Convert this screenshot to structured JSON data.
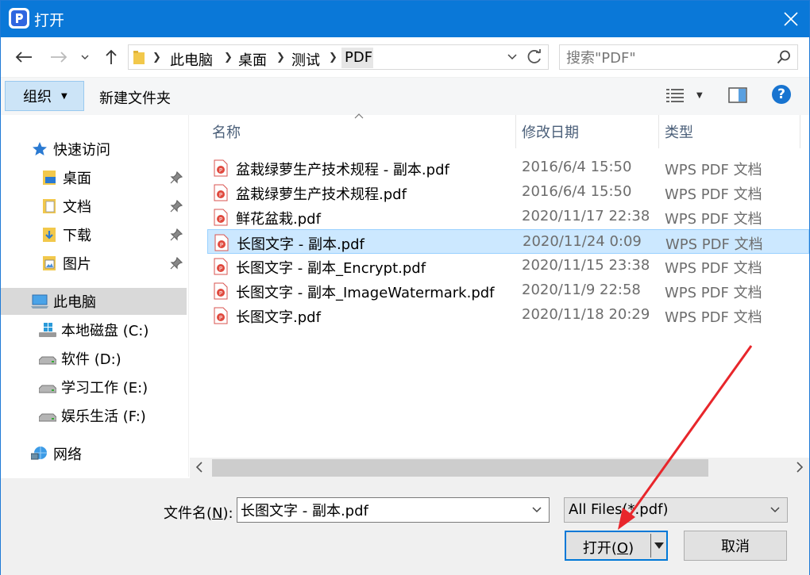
{
  "window": {
    "title": "打开"
  },
  "address": {
    "crumbs": [
      "此电脑",
      "桌面",
      "测试",
      "PDF"
    ]
  },
  "search": {
    "placeholder": "搜索\"PDF\""
  },
  "toolbar": {
    "organize_label": "组织",
    "new_folder_label": "新建文件夹",
    "help_label": "?"
  },
  "navpane": {
    "quick_access": "快速访问",
    "quick_items": [
      "桌面",
      "文档",
      "下载",
      "图片"
    ],
    "this_pc": "此电脑",
    "drives": [
      "本地磁盘 (C:)",
      "软件 (D:)",
      "学习工作 (E:)",
      "娱乐生活 (F:)"
    ],
    "network": "网络"
  },
  "filelist": {
    "columns": [
      "名称",
      "修改日期",
      "类型"
    ],
    "rows": [
      {
        "name": "盆栽绿萝生产技术规程 - 副本.pdf",
        "date": "2016/6/4 15:50",
        "type": "WPS PDF 文档"
      },
      {
        "name": "盆栽绿萝生产技术规程.pdf",
        "date": "2016/6/4 15:50",
        "type": "WPS PDF 文档"
      },
      {
        "name": "鲜花盆栽.pdf",
        "date": "2020/11/17 22:38",
        "type": "WPS PDF 文档"
      },
      {
        "name": "长图文字 - 副本.pdf",
        "date": "2020/11/24 0:09",
        "type": "WPS PDF 文档",
        "selected": true
      },
      {
        "name": "长图文字 - 副本_Encrypt.pdf",
        "date": "2020/11/15 23:38",
        "type": "WPS PDF 文档"
      },
      {
        "name": "长图文字 - 副本_ImageWatermark.pdf",
        "date": "2020/11/9 22:58",
        "type": "WPS PDF 文档"
      },
      {
        "name": "长图文字.pdf",
        "date": "2020/11/18 20:29",
        "type": "WPS PDF 文档"
      }
    ]
  },
  "bottom": {
    "filename_label_pre": "文件名(",
    "filename_label_key": "N",
    "filename_label_post": "):",
    "filename_value": "长图文字 - 副本.pdf",
    "filetype_value": "All Files(*.pdf)",
    "open_label_pre": "打开(",
    "open_label_key": "O",
    "open_label_post": ")",
    "cancel_label": "取消"
  },
  "colors": {
    "titlebar": "#0a78d8",
    "selection": "#cce8ff",
    "annotation_arrow": "#e8262b"
  }
}
